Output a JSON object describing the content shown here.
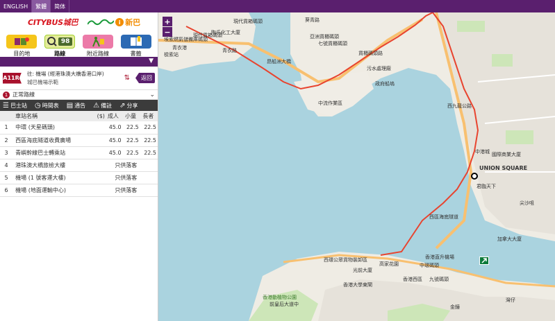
{
  "topbar": {
    "languages": [
      "ENGLISH",
      "繁體",
      "简体"
    ],
    "active": "繁體"
  },
  "logos": {
    "citybus": "CITYBUS城巴",
    "nwfb": "新巴"
  },
  "nav": [
    {
      "label": "目的地"
    },
    {
      "label": "路線",
      "badge": "98"
    },
    {
      "label": "附近路線"
    },
    {
      "label": "書籤"
    }
  ],
  "route": {
    "number": "A11R",
    "destination": "往: 機場 (經港珠澳大橋香港口岸)",
    "from": "城巴機場示範",
    "back_label": "返回"
  },
  "variant": {
    "index": "1",
    "label": "正常路線"
  },
  "toolbar": [
    {
      "label": "巴士站",
      "icon": "bus-stop-list-icon"
    },
    {
      "label": "時間表",
      "icon": "clock-icon"
    },
    {
      "label": "通告",
      "icon": "notice-icon"
    },
    {
      "label": "備註",
      "icon": "warning-icon"
    },
    {
      "label": "分享",
      "icon": "share-icon"
    }
  ],
  "table": {
    "headers": {
      "name": "車站名稱",
      "currency": "($)",
      "adult": "成人",
      "child": "小童",
      "senior": "長者"
    },
    "rows": [
      {
        "no": "1",
        "name": "中環 (天星碼頭)",
        "adult": "45.0",
        "child": "22.5",
        "senior": "22.5"
      },
      {
        "no": "2",
        "name": "西區海底隧道收費廣場",
        "adult": "45.0",
        "child": "22.5",
        "senior": "22.5"
      },
      {
        "no": "3",
        "name": "青嶼幹線巴士轉乘站",
        "adult": "45.0",
        "child": "22.5",
        "senior": "22.5"
      },
      {
        "no": "4",
        "name": "港珠澳大橋旅檢大樓",
        "note": "只供落客"
      },
      {
        "no": "5",
        "name": "機場 (1 號客運大樓)",
        "note": "只供落客"
      },
      {
        "no": "6",
        "name": "機場 (地面運輸中心)",
        "note": "只供落客"
      }
    ]
  },
  "map": {
    "zoom_in": "+",
    "zoom_out": "−",
    "route_color": "#e8442f",
    "labels": [
      "現代貨箱碼頭",
      "現代貨箱碼頭",
      "陶氏化工大廈",
      "埃索燃氣儲備庫碼頭",
      "青衣港",
      "檢索站",
      "青衣路",
      "葵青路",
      "亞洲貨櫃碼頭",
      "七號貨櫃碼頭",
      "貨櫃碼頭路",
      "污水處理廠",
      "政府船塢",
      "中流作業區",
      "昂船洲大橋",
      "西九龍公路",
      "中港城",
      "國際商業大廈",
      "UNION SQUARE",
      "君臨天下",
      "尖沙咀",
      "西區海底隧道",
      "西環公眾貨物裝卸區",
      "高家花園",
      "光前大廈",
      "香港西區",
      "香港大學東閘",
      "中環碼頭",
      "香港直升機場",
      "金鐘",
      "灣仔",
      "前皇后大道中",
      "香港動植物公園",
      "九號碼頭",
      "加拿大大廈"
    ]
  }
}
